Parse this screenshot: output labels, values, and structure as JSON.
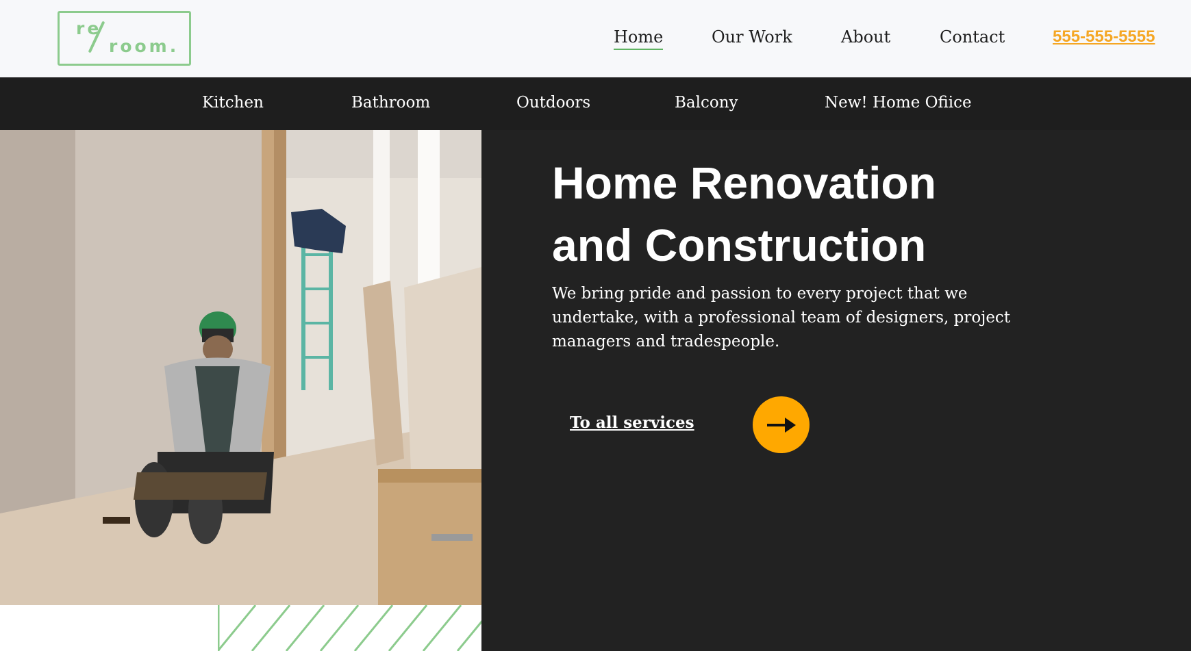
{
  "header": {
    "logo": {
      "top": "re",
      "bottom": "room."
    },
    "nav": [
      {
        "label": "Home",
        "active": true
      },
      {
        "label": "Our Work",
        "active": false
      },
      {
        "label": "About",
        "active": false
      },
      {
        "label": "Contact",
        "active": false
      }
    ],
    "phone": "555-555-5555"
  },
  "categories": [
    {
      "label": "Kitchen"
    },
    {
      "label": "Bathroom"
    },
    {
      "label": "Outdoors"
    },
    {
      "label": "Balcony"
    },
    {
      "label": "New! Home Ofiice"
    }
  ],
  "hero": {
    "title_line1": "Home Renovation",
    "title_line2": "and Construction",
    "description": "We bring pride and passion to every project that we undertake, with a professional team of designers, project managers and tradespeople.",
    "cta_label": "To all services",
    "cta_icon": "arrow-right-icon",
    "image": "construction-worker-photo"
  },
  "colors": {
    "logo_green": "#8ccb8d",
    "accent_orange": "#ffa800",
    "phone_orange": "#f5a623",
    "dark_bg": "#222222",
    "category_bar": "#1e1e1e",
    "header_bg": "#f7f8fa"
  }
}
